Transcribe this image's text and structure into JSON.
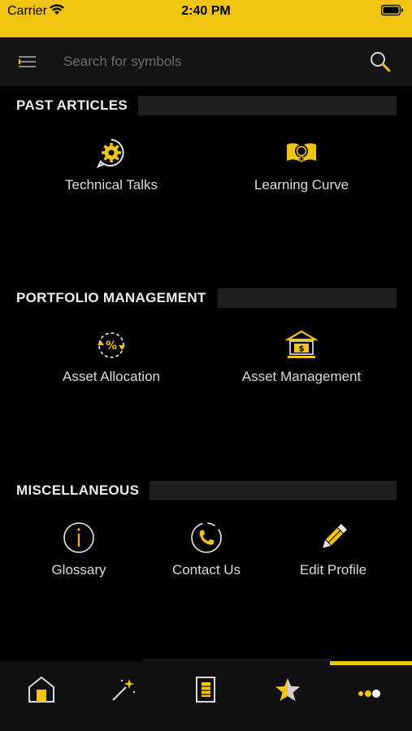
{
  "status_bar": {
    "carrier": "Carrier",
    "time": "2:40 PM"
  },
  "search": {
    "placeholder": "Search for symbols"
  },
  "sections": [
    {
      "title": "PAST ARTICLES",
      "items": [
        {
          "label": "Technical Talks",
          "icon": "gear-chat-icon"
        },
        {
          "label": "Learning Curve",
          "icon": "book-bulb-icon"
        }
      ]
    },
    {
      "title": "PORTFOLIO MANAGEMENT",
      "items": [
        {
          "label": "Asset Allocation",
          "icon": "percent-cycle-icon"
        },
        {
          "label": "Asset Management",
          "icon": "bank-icon"
        }
      ]
    },
    {
      "title": "MISCELLANEOUS",
      "items": [
        {
          "label": "Glossary",
          "icon": "info-icon"
        },
        {
          "label": "Contact Us",
          "icon": "phone-icon"
        },
        {
          "label": "Edit Profile",
          "icon": "pencil-icon"
        }
      ]
    }
  ],
  "tabs": [
    {
      "icon": "home-icon"
    },
    {
      "icon": "magic-wand-icon"
    },
    {
      "icon": "document-icon"
    },
    {
      "icon": "star-icon"
    },
    {
      "icon": "more-dots-icon",
      "active": true
    }
  ],
  "colors": {
    "accent": "#f1c40f",
    "background": "#000000",
    "bar": "#141414"
  }
}
